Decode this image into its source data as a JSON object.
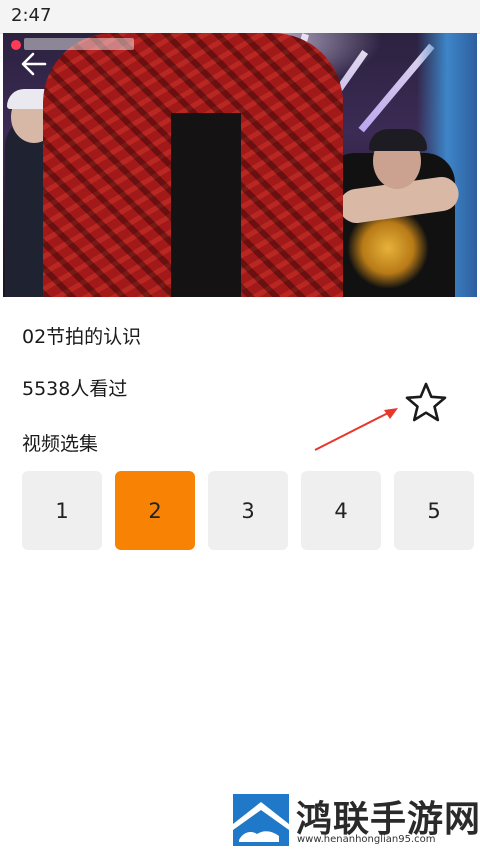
{
  "status_bar": {
    "time": "2:47"
  },
  "video": {
    "icon_back": "arrow-left-icon"
  },
  "course": {
    "title": "02节拍的认识",
    "views": "5538人看过",
    "favorite_icon": "star-outline-icon"
  },
  "episodes": {
    "label": "视频选集",
    "items": [
      "1",
      "2",
      "3",
      "4",
      "5"
    ],
    "selected": "2",
    "accent": "#f88204"
  },
  "watermark": {
    "name": "鸿联手游网",
    "url": "www.henanhonglian95.com"
  }
}
